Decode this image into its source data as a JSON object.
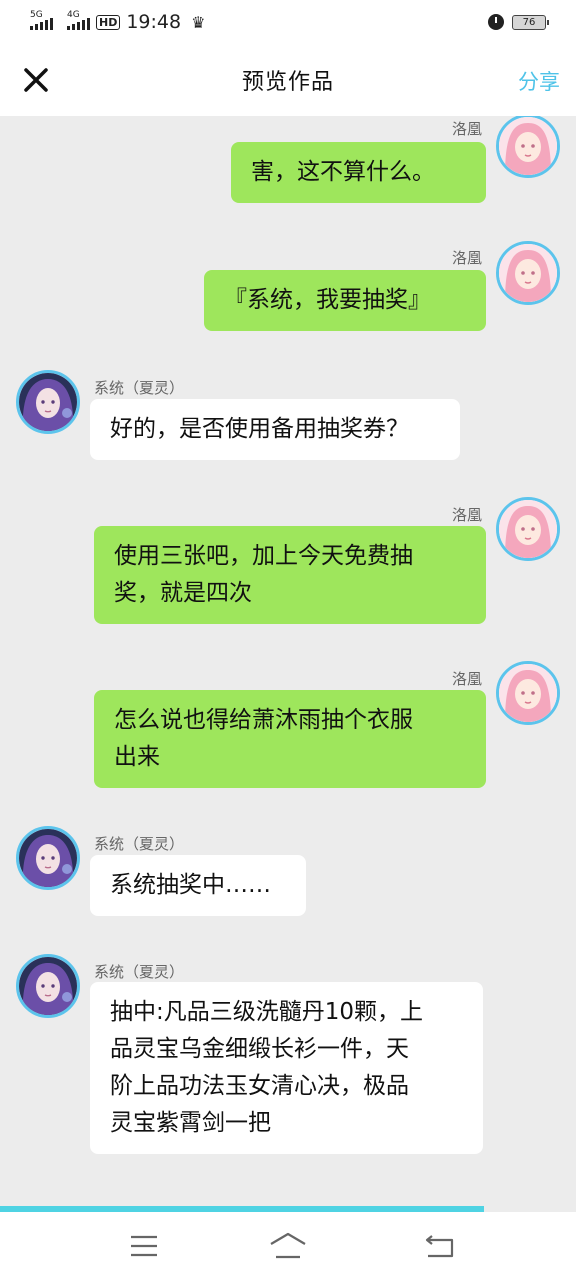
{
  "status_bar": {
    "network1": "5G",
    "network2": "4G",
    "hd": "HD",
    "time": "19:48",
    "battery": "76"
  },
  "header": {
    "title": "预览作品",
    "share_label": "分享"
  },
  "messages": [
    {
      "side": "right",
      "sender": "洛凰",
      "lines": [
        "害，这不算什么。"
      ]
    },
    {
      "side": "right",
      "sender": "洛凰",
      "lines": [
        "『系统，我要抽奖』"
      ]
    },
    {
      "side": "left",
      "sender": "系统（夏灵）",
      "lines": [
        "好的，是否使用备用抽奖券？"
      ]
    },
    {
      "side": "right",
      "sender": "洛凰",
      "lines": [
        "使用三张吧，加上今天免费抽",
        "奖，就是四次"
      ]
    },
    {
      "side": "right",
      "sender": "洛凰",
      "lines": [
        "怎么说也得给萧沐雨抽个衣服",
        "出来"
      ]
    },
    {
      "side": "left",
      "sender": "系统（夏灵）",
      "lines": [
        "系统抽奖中……"
      ]
    },
    {
      "side": "left",
      "sender": "系统（夏灵）",
      "lines": [
        "抽中:凡品三级洗髓丹10颗，上",
        "品灵宝乌金细缎长衫一件，天",
        "阶上品功法玉女清心决，极品",
        "灵宝紫霄剑一把"
      ]
    }
  ],
  "colors": {
    "accent": "#4fc3e8",
    "bubble_green": "#9ee65c",
    "bubble_white": "#ffffff",
    "background": "#ececec"
  },
  "icons": {
    "close": "close-icon",
    "menu": "menu-icon",
    "home": "home-icon",
    "back": "back-icon"
  }
}
